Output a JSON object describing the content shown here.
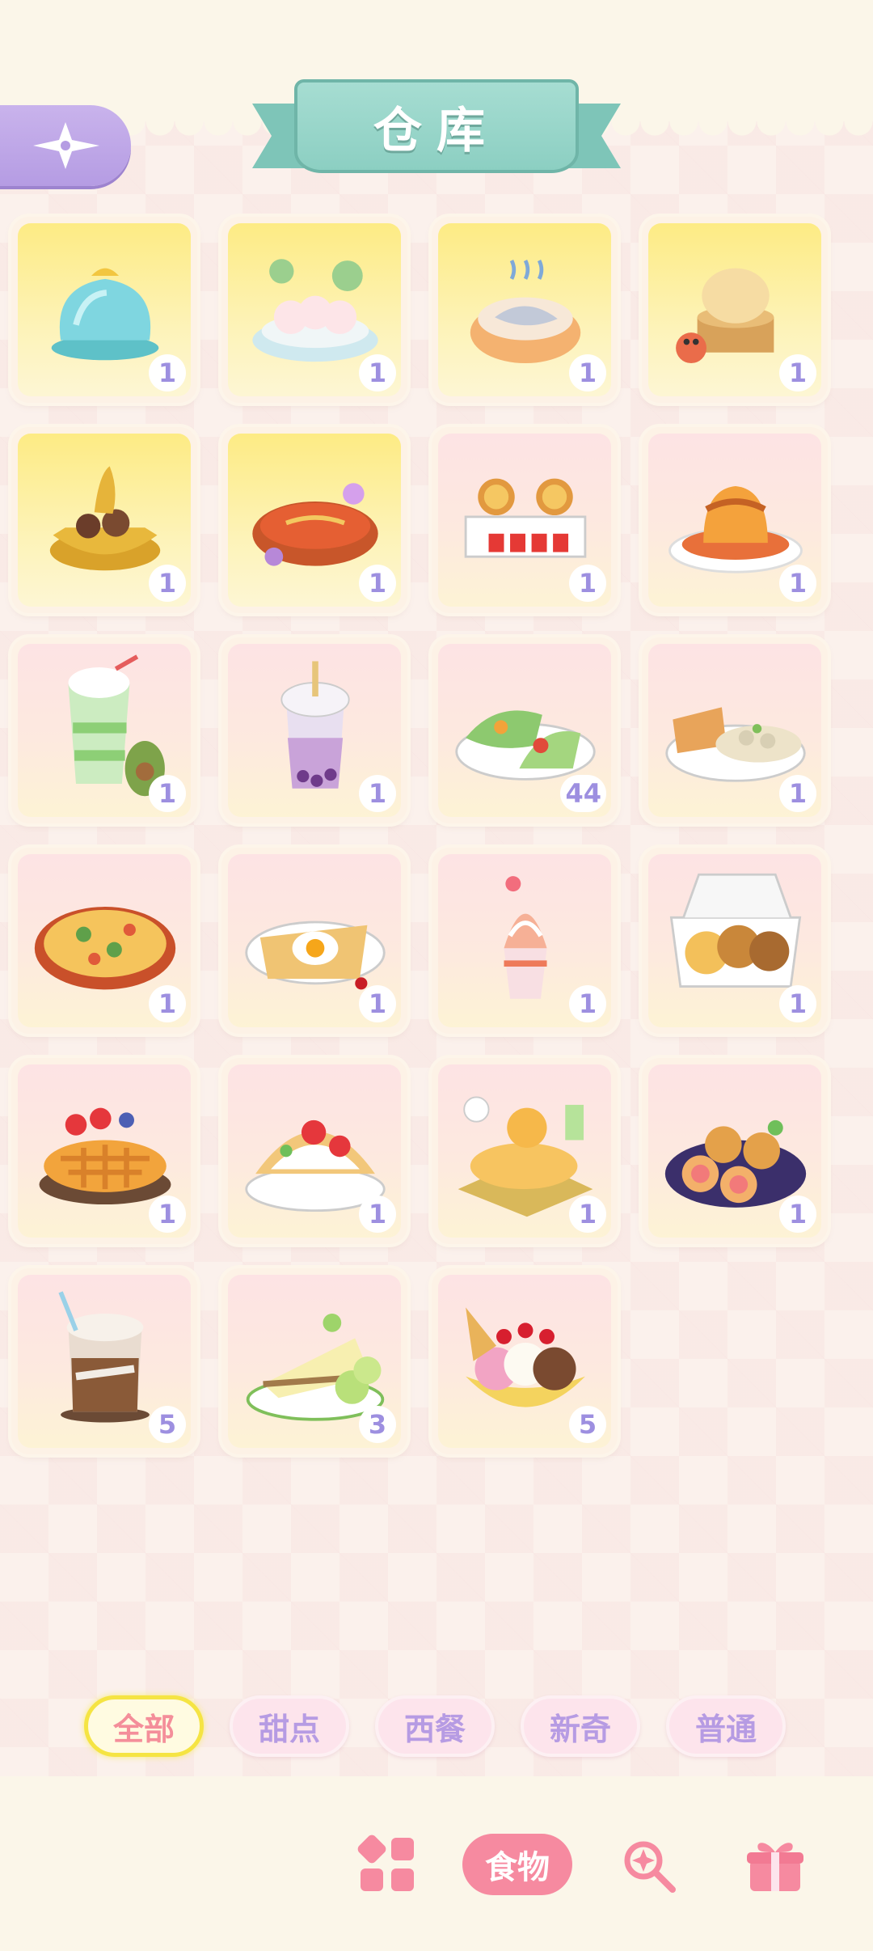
{
  "header": {
    "title": "仓库",
    "back_icon": "compass-star-icon"
  },
  "colors": {
    "gold_card": "#fdeb84",
    "pink_card": "#fde3e4",
    "badge_text": "#9d8fe0",
    "active_tab_border": "#f5e443",
    "nav_active": "#f68aa0",
    "ribbon": "#8ccfc2"
  },
  "items": [
    {
      "name": "blue jelly dessert",
      "icon": "jelly-icon",
      "rarity": "gold",
      "qty": "1"
    },
    {
      "name": "bunny rice balls",
      "icon": "bunny-dumpling-icon",
      "rarity": "gold",
      "qty": "1"
    },
    {
      "name": "fish in bowl",
      "icon": "fish-bowl-icon",
      "rarity": "gold",
      "qty": "1"
    },
    {
      "name": "crab soup dumpling",
      "icon": "crab-bun-icon",
      "rarity": "gold",
      "qty": "1"
    },
    {
      "name": "golden hotpot",
      "icon": "hotpot-icon",
      "rarity": "gold",
      "qty": "1"
    },
    {
      "name": "red spicy soup",
      "icon": "spicy-soup-icon",
      "rarity": "gold",
      "qty": "1"
    },
    {
      "name": "egg tarts box",
      "icon": "egg-tart-icon",
      "rarity": "pink",
      "qty": "1"
    },
    {
      "name": "pudding plate",
      "icon": "pudding-icon",
      "rarity": "pink",
      "qty": "1"
    },
    {
      "name": "avocado smoothie",
      "icon": "smoothie-icon",
      "rarity": "pink",
      "qty": "1"
    },
    {
      "name": "taro bubble tea",
      "icon": "bubble-tea-icon",
      "rarity": "pink",
      "qty": "1"
    },
    {
      "name": "veggie wraps",
      "icon": "wrap-icon",
      "rarity": "pink",
      "qty": "44"
    },
    {
      "name": "toast with stew",
      "icon": "toast-stew-icon",
      "rarity": "pink",
      "qty": "1"
    },
    {
      "name": "baked gratin",
      "icon": "gratin-icon",
      "rarity": "pink",
      "qty": "1"
    },
    {
      "name": "egg crepe",
      "icon": "crepe-icon",
      "rarity": "pink",
      "qty": "1"
    },
    {
      "name": "strawberry sundae",
      "icon": "sundae-icon",
      "rarity": "pink",
      "qty": "1"
    },
    {
      "name": "bun box",
      "icon": "bun-box-icon",
      "rarity": "pink",
      "qty": "1"
    },
    {
      "name": "fruit lattice pie",
      "icon": "pie-icon",
      "rarity": "pink",
      "qty": "1"
    },
    {
      "name": "strawberry taco",
      "icon": "taco-icon",
      "rarity": "pink",
      "qty": "1"
    },
    {
      "name": "chick pancake platter",
      "icon": "pancake-platter-icon",
      "rarity": "pink",
      "qty": "1"
    },
    {
      "name": "swiss roll plate",
      "icon": "swiss-roll-icon",
      "rarity": "pink",
      "qty": "1"
    },
    {
      "name": "iced mocha",
      "icon": "iced-coffee-icon",
      "rarity": "pink",
      "qty": "5"
    },
    {
      "name": "lime cheesecake",
      "icon": "cheesecake-icon",
      "rarity": "pink",
      "qty": "3"
    },
    {
      "name": "banana split",
      "icon": "banana-split-icon",
      "rarity": "pink",
      "qty": "5"
    }
  ],
  "filters": [
    {
      "label": "全部",
      "active": true
    },
    {
      "label": "甜点",
      "active": false
    },
    {
      "label": "西餐",
      "active": false
    },
    {
      "label": "新奇",
      "active": false
    },
    {
      "label": "普通",
      "active": false
    }
  ],
  "bottom_nav": {
    "grid_icon": "grid-icon",
    "food_label": "食物",
    "tool_icon": "magic-wand-icon",
    "gift_icon": "gift-box-icon"
  }
}
